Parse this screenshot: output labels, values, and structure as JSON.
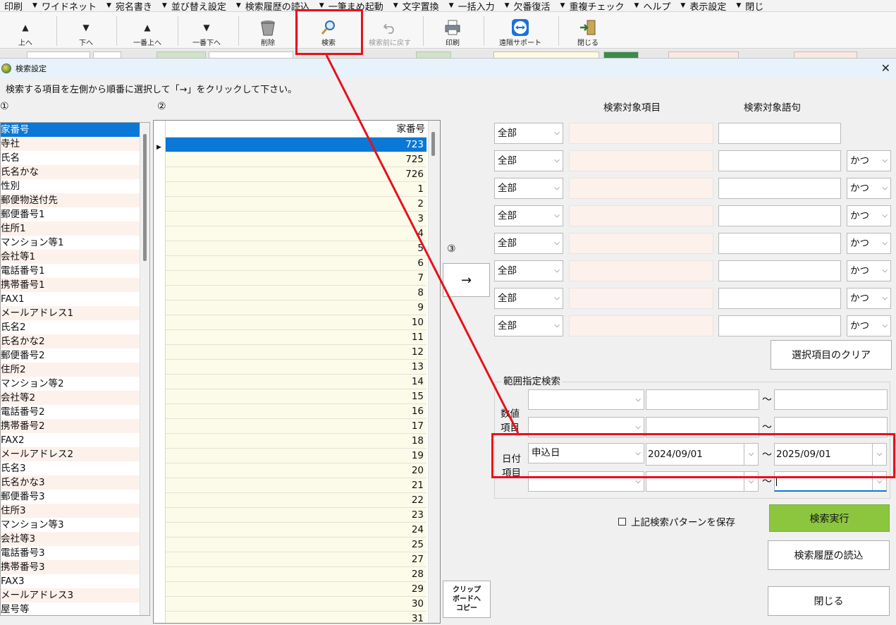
{
  "menu": [
    "印刷",
    "ワイドネット",
    "宛名書き",
    "並び替え設定",
    "検索履歴の読込",
    "一筆まめ起動",
    "文字置換",
    "一括入力",
    "欠番復活",
    "重複チェック",
    "ヘルプ",
    "表示設定",
    "閉じ"
  ],
  "toolbar": {
    "up": "上へ",
    "down": "下へ",
    "top": "一番上へ",
    "bottom": "一番下へ",
    "delete": "削除",
    "search": "検索",
    "undo_search": "検索前に戻す",
    "print": "印刷",
    "remote": "遠隔サポート",
    "close": "閉じる"
  },
  "dialog": {
    "title": "検索設定",
    "instruction": "検索する項目を左側から順番に選択して「→」をクリックして下さい。",
    "label1": "①",
    "label2": "②",
    "label3": "③",
    "arrow": "→",
    "clipboard": [
      "クリップ",
      "ボードへ",
      "コピー"
    ]
  },
  "fields": [
    "家番号",
    "寺社",
    "氏名",
    "氏名かな",
    "性別",
    "郵便物送付先",
    "郵便番号1",
    "住所1",
    "マンション等1",
    "会社等1",
    "電話番号1",
    "携帯番号1",
    "FAX1",
    "メールアドレス1",
    "氏名2",
    "氏名かな2",
    "郵便番号2",
    "住所2",
    "マンション等2",
    "会社等2",
    "電話番号2",
    "携帯番号2",
    "FAX2",
    "メールアドレス2",
    "氏名3",
    "氏名かな3",
    "郵便番号3",
    "住所3",
    "マンション等3",
    "会社等3",
    "電話番号3",
    "携帯番号3",
    "FAX3",
    "メールアドレス3",
    "屋号等"
  ],
  "grid": {
    "header": "家番号",
    "rows": [
      "723",
      "725",
      "726",
      "1",
      "2",
      "3",
      "4",
      "5",
      "6",
      "7",
      "8",
      "9",
      "10",
      "11",
      "12",
      "13",
      "14",
      "15",
      "16",
      "17",
      "18",
      "19",
      "20",
      "21",
      "22",
      "23",
      "24",
      "25",
      "27",
      "28",
      "29",
      "30",
      "31"
    ]
  },
  "criteria": {
    "header_item": "検索対象項目",
    "header_term": "検索対象語句",
    "scope": "全部",
    "conj": "かつ",
    "clear": "選択項目のクリア"
  },
  "range": {
    "title": "範囲指定検索",
    "num_label": "数値\n項目",
    "num_label_1": "数値",
    "num_label_2": "項目",
    "date_label_1": "日付",
    "date_label_2": "項目",
    "date_item": "申込日",
    "date_from": "2024/09/01",
    "date_to": "2025/09/01",
    "tilde": "～"
  },
  "save_pattern": "上記検索パターンを保存",
  "execute": "検索実行",
  "load_history": "検索履歴の読込",
  "close": "閉じる"
}
